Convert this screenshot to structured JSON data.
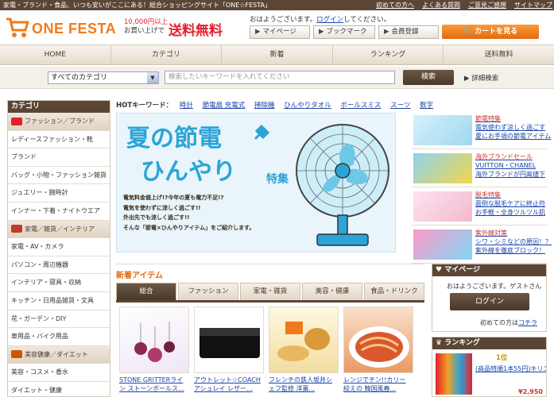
{
  "topbar": {
    "tagline": "家電・ブランド・食品、いつも安いがここにある！総合ショッピングサイト「ONE☆FESTA」",
    "links": [
      "初めての方へ",
      "よくある質問",
      "ご意見ご感想",
      "サイトマップ"
    ]
  },
  "header": {
    "logo": "ONE FESTA",
    "promo_line1": "10,000円以上",
    "promo_line2": "お買い上げで",
    "promo_big": "送料無料",
    "greeting_prefix": "おはようございます。",
    "greeting_link": "ログイン",
    "greeting_suffix": "してください。",
    "buttons": [
      "マイページ",
      "ブックマーク",
      "会員登録"
    ],
    "cart": "カートを見る"
  },
  "nav": [
    "HOME",
    "カテゴリ",
    "新着",
    "ランキング",
    "送料無料"
  ],
  "search": {
    "category": "すべてのカテゴリ",
    "placeholder": "検索したいキーワードを入れてください",
    "button": "検索",
    "advanced": "詳細検索"
  },
  "sidebar": {
    "title": "カテゴリ",
    "items": [
      {
        "label": "ファッション／ブランド",
        "cat": true,
        "color": "#e4202e"
      },
      {
        "label": "レディースファッション・靴"
      },
      {
        "label": "ブランド"
      },
      {
        "label": "バッグ・小物・ファッション雑貨"
      },
      {
        "label": "ジュエリー・腕時計"
      },
      {
        "label": "インナー・下着・ナイトウエア"
      },
      {
        "label": "家電／雑貨／インテリア",
        "cat": true,
        "color": "#c0392b"
      },
      {
        "label": "家電・AV・カメラ"
      },
      {
        "label": "パソコン・周辺機器"
      },
      {
        "label": "インテリア・寝具・収納"
      },
      {
        "label": "キッチン・日用品雑貨・文具"
      },
      {
        "label": "花・ガーデン・DIY"
      },
      {
        "label": "車用品・バイク用品"
      },
      {
        "label": "美容健康／ダイエット",
        "cat": true,
        "color": "#d35400"
      },
      {
        "label": "美容・コスメ・香水"
      },
      {
        "label": "ダイエット・健康"
      }
    ]
  },
  "hot": {
    "label": "HOTキーワード：",
    "keywords": [
      "時計",
      "節電扇 充電式",
      "掃除機",
      "ひんやりタオル",
      "ボールスミス",
      "スーツ",
      "数字"
    ]
  },
  "banner": {
    "line1": "夏の節電",
    "line2": "ひんやり",
    "line3": "特集",
    "copy": [
      "電気料金値上げ!?今年の夏も電力不足!?",
      "電気を使わずに涼しく過ごす!!",
      "外出先でも涼しく過ごす!!",
      "そんな「節電×ひんやりアイテム」をご紹介します。"
    ]
  },
  "right_promos": [
    {
      "title": "節電特集",
      "l1": "電気使わず涼しく過ごす",
      "l2": "夏にお手頃の節電アイテム"
    },
    {
      "title": "海外ブランドセール",
      "l1": "VUITTON・CHANEL",
      "l2": "海外ブランドが円高値下"
    },
    {
      "title": "脱毛特集",
      "l1": "面倒な脱毛ケアに終止符",
      "l2": "お手軽・全身ツルツル肌"
    },
    {
      "title": "紫外線対策",
      "l1": "シワ・シミなどの原因！？",
      "l2": "紫外線を徹底ブロック！"
    }
  ],
  "new_items": {
    "heading": "新着アイテム",
    "tabs": [
      "総合",
      "ファッション",
      "家電・雑貨",
      "美容・健康",
      "食品・ドリンク"
    ],
    "active_tab": 0,
    "products": [
      {
        "name": "STONE GRITTERライン ストーンボールス..."
      },
      {
        "name": "アウトレット☆COACH アシュレイ レザー..."
      },
      {
        "name": "フレンチの鉄人坂井シ ェフ監修 洋菓..."
      },
      {
        "name": "レンジでチン!!カリー 絞えの 韓国風春..."
      }
    ]
  },
  "mypage": {
    "title": "マイページ",
    "greeting": "おはようございます。ゲストさん",
    "login": "ログイン",
    "first_prefix": "初めての方は",
    "first_link": "コチラ"
  },
  "ranking": {
    "title": "ランキング",
    "rank_no": "1位",
    "item": "(商品特順1本55円)キリン人気...",
    "price": "¥2,950"
  }
}
